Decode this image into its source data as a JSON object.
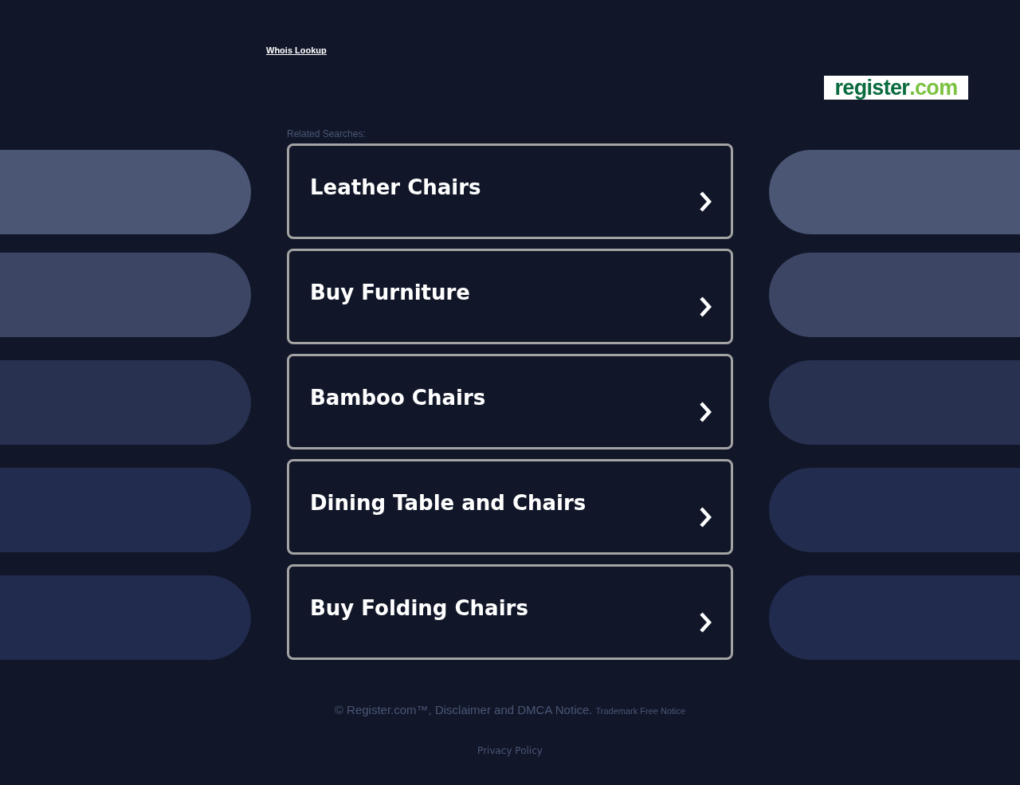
{
  "header": {
    "whois_link": "Whois Lookup",
    "logo": {
      "name": "register",
      "suffix": ".com"
    }
  },
  "related_searches": {
    "heading": "Related Searches:",
    "items": [
      {
        "label": "Leather Chairs"
      },
      {
        "label": "Buy Furniture"
      },
      {
        "label": "Bamboo Chairs"
      },
      {
        "label": "Dining Table and Chairs"
      },
      {
        "label": "Buy Folding Chairs"
      }
    ]
  },
  "footer": {
    "notice": "© Register.com™, Disclaimer and DMCA Notice.",
    "trademark": "Trademark Free Notice",
    "privacy": "Privacy Policy"
  }
}
